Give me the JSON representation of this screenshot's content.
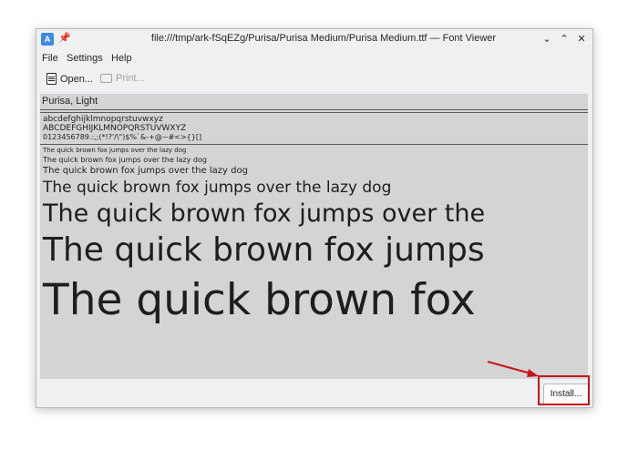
{
  "window": {
    "title": "file:///tmp/ark-fSqEZg/Purisa/Purisa Medium/Purisa Medium.ttf — Font Viewer",
    "app_icon_label": "A"
  },
  "menu": [
    "File",
    "Settings",
    "Help"
  ],
  "toolbar": {
    "open_label": "Open...",
    "print_label": "Print..."
  },
  "preview": {
    "font_name": "Purisa, Light",
    "lowercase": "abcdefghijklmnopqrstuvwxyz",
    "uppercase": "ABCDEFGHIJKLMNOPQRSTUVWXYZ",
    "digits": "0123456789.:,;(*!?'/\\\")$%`&-+@~#<>{}[]",
    "samples": [
      "The quick brown fox jumps over the lazy dog",
      "The quick brown fox jumps over the lazy dog",
      "The quick brown fox jumps over the lazy dog",
      "The quick brown fox jumps over the lazy dog",
      "The quick brown fox jumps over the",
      "The quick brown fox jumps",
      "The quick brown fox"
    ]
  },
  "install_label": "Install...",
  "colors": {
    "highlight": "#c5151c",
    "preview_bg": "#d4d4d4"
  }
}
